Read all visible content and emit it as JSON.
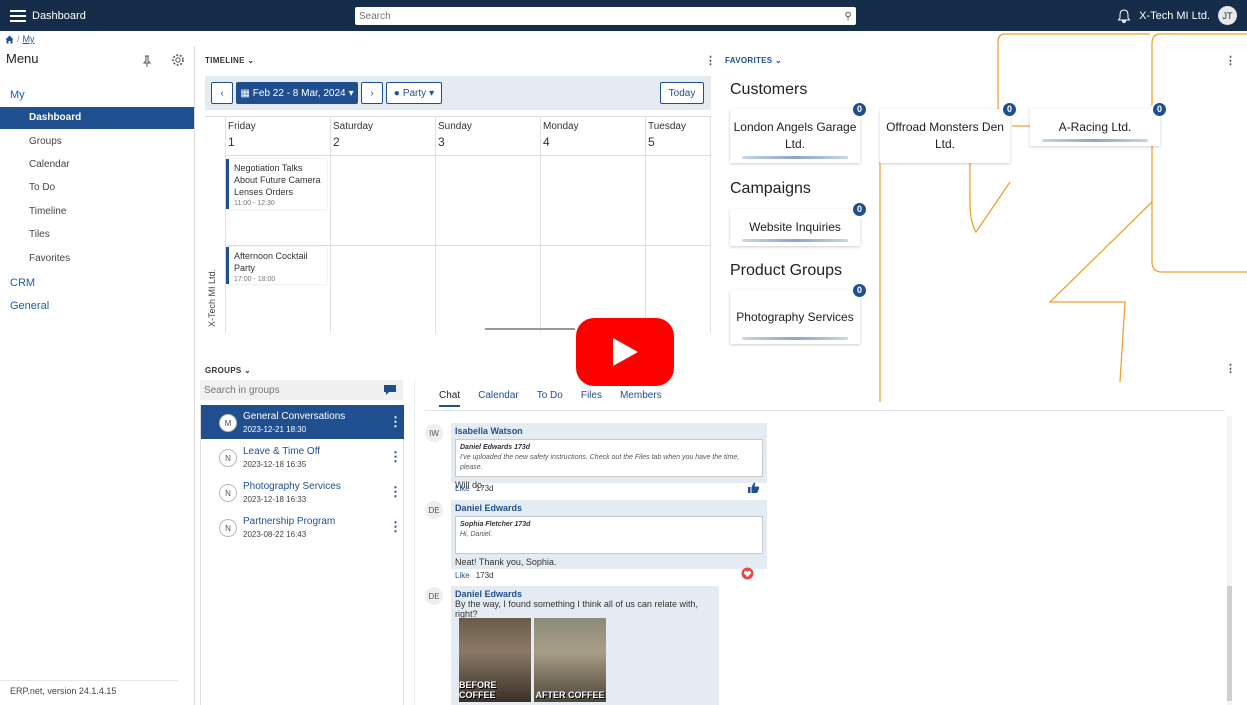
{
  "topbar": {
    "title": "Dashboard",
    "search_placeholder": "Search",
    "company": "X-Tech MI Ltd.",
    "avatar": "JT"
  },
  "breadcrumb": {
    "current": "My"
  },
  "sidebar": {
    "heading": "Menu",
    "groups": [
      "My",
      "CRM",
      "General"
    ],
    "items": [
      "Dashboard",
      "Groups",
      "Calendar",
      "To Do",
      "Timeline",
      "Tiles",
      "Favorites"
    ],
    "active_item": "Dashboard",
    "version": "ERP.net, version 24.1.4.15"
  },
  "timeline": {
    "title": "TIMELINE",
    "date_range": "Feb 22 - 8 Mar, 2024",
    "filter": "Party",
    "today": "Today",
    "days": [
      {
        "name": "Friday",
        "num": "1"
      },
      {
        "name": "Saturday",
        "num": "2"
      },
      {
        "name": "Sunday",
        "num": "3"
      },
      {
        "name": "Monday",
        "num": "4"
      },
      {
        "name": "Tuesday",
        "num": "5"
      }
    ],
    "row_label": "X-Tech MI Ltd.",
    "events": [
      {
        "title": "Negotiation Talks About Future Camera Lenses Orders",
        "time": "11:00 - 12:30"
      },
      {
        "title": "Afternoon Cocktail Party",
        "time": "17:00 - 18:00"
      }
    ]
  },
  "favorites": {
    "title": "FAVORITES",
    "categories": [
      {
        "name": "Customers",
        "cards": [
          {
            "label": "London Angels Garage Ltd.",
            "count": "0"
          },
          {
            "label": "Offroad Monsters Den Ltd.",
            "count": "0"
          },
          {
            "label": "A-Racing Ltd.",
            "count": "0"
          }
        ]
      },
      {
        "name": "Campaigns",
        "cards": [
          {
            "label": "Website Inquiries",
            "count": "0"
          }
        ]
      },
      {
        "name": "Product Groups",
        "cards": [
          {
            "label": "Photography Services",
            "count": "0"
          }
        ]
      }
    ]
  },
  "groups": {
    "title": "GROUPS",
    "search_placeholder": "Search in groups",
    "list": [
      {
        "name": "General Conversations",
        "date": "2023-12-21 18:30",
        "icon": "M",
        "active": true
      },
      {
        "name": "Leave & Time Off",
        "date": "2023-12-18 16:35",
        "icon": "N"
      },
      {
        "name": "Photography Services",
        "date": "2023-12-18 16:33",
        "icon": "N"
      },
      {
        "name": "Partnership Program",
        "date": "2023-08-22 16:43",
        "icon": "N"
      }
    ]
  },
  "chat": {
    "tabs": [
      "Chat",
      "Calendar",
      "To Do",
      "Files",
      "Members"
    ],
    "active_tab": "Chat",
    "messages": [
      {
        "initials": "IW",
        "author": "Isabella Watson",
        "quote_author": "Daniel Edwards  173d",
        "quote_text": "I've uploaded the new safety instructions. Check out the Files tab when you have the time, please.",
        "text": "Will do.",
        "like": "Like",
        "age": "173d"
      },
      {
        "initials": "DE",
        "author": "Daniel Edwards",
        "quote_author": "Sophia Fletcher  173d",
        "quote_text": "Hi, Daniel.",
        "text": "Neat! Thank you, Sophia.",
        "like": "Like",
        "age": "173d"
      },
      {
        "initials": "DE",
        "author": "Daniel Edwards",
        "text": "By the way, I found something I think all of us can relate with, right?",
        "image_captions": [
          "BEFORE COFFEE",
          "AFTER COFFEE"
        ]
      }
    ]
  },
  "colors": {
    "topbar": "#152c4a",
    "accent": "#1f4f8f",
    "orange_lines": "#f0a030",
    "play_button": "#ff0000"
  }
}
